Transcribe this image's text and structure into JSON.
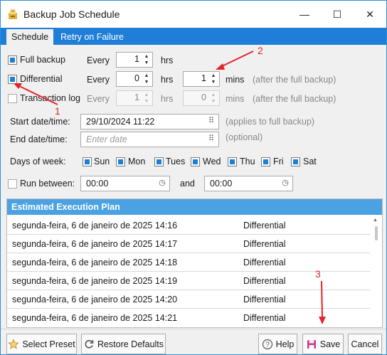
{
  "window": {
    "title": "Backup Job Schedule",
    "minimize": "—",
    "maximize": "☐",
    "close": "✕"
  },
  "tabs": [
    {
      "label": "Schedule"
    },
    {
      "label": "Retry on Failure"
    }
  ],
  "backup_types": {
    "full": {
      "label": "Full backup",
      "checked": true,
      "every_label": "Every",
      "value": "1",
      "unit": "hrs"
    },
    "differential": {
      "label": "Differential",
      "checked": true,
      "every_label": "Every",
      "hours": "0",
      "hours_unit": "hrs",
      "mins": "1",
      "mins_unit": "mins",
      "note": "(after the full backup)"
    },
    "transaction": {
      "label": "Transaction log",
      "checked": false,
      "every_label": "Every",
      "hours": "1",
      "hours_unit": "hrs",
      "mins": "0",
      "mins_unit": "mins",
      "note": "(after the full backup)"
    }
  },
  "start_date": {
    "label": "Start date/time:",
    "value": "29/10/2024 11:22",
    "note": "(applies to full backup)"
  },
  "end_date": {
    "label": "End date/time:",
    "placeholder": "Enter date",
    "note": "(optional)"
  },
  "days": {
    "label": "Days of week:",
    "items": [
      {
        "label": "Sun",
        "checked": true
      },
      {
        "label": "Mon",
        "checked": true
      },
      {
        "label": "Tues",
        "checked": true
      },
      {
        "label": "Wed",
        "checked": true
      },
      {
        "label": "Thu",
        "checked": true
      },
      {
        "label": "Fri",
        "checked": true
      },
      {
        "label": "Sat",
        "checked": true
      }
    ]
  },
  "run_between": {
    "label": "Run between:",
    "checked": false,
    "from": "00:00",
    "and_label": "and",
    "to": "00:00"
  },
  "plan": {
    "header": "Estimated Execution Plan",
    "rows": [
      {
        "date": "segunda-feira, 6 de janeiro de 2025 14:16",
        "type": "Differential"
      },
      {
        "date": "segunda-feira, 6 de janeiro de 2025 14:17",
        "type": "Differential"
      },
      {
        "date": "segunda-feira, 6 de janeiro de 2025 14:18",
        "type": "Differential"
      },
      {
        "date": "segunda-feira, 6 de janeiro de 2025 14:19",
        "type": "Differential"
      },
      {
        "date": "segunda-feira, 6 de janeiro de 2025 14:20",
        "type": "Differential"
      },
      {
        "date": "segunda-feira, 6 de janeiro de 2025 14:21",
        "type": "Differential"
      }
    ]
  },
  "buttons": {
    "select_preset": "Select Preset",
    "restore_defaults": "Restore Defaults",
    "help": "Help",
    "save": "Save",
    "cancel": "Cancel"
  },
  "annotations": {
    "one": "1",
    "two": "2",
    "three": "3"
  },
  "colors": {
    "accent": "#1f7fd8",
    "plan_header": "#4ba2e3",
    "annotation": "#e3242b"
  }
}
